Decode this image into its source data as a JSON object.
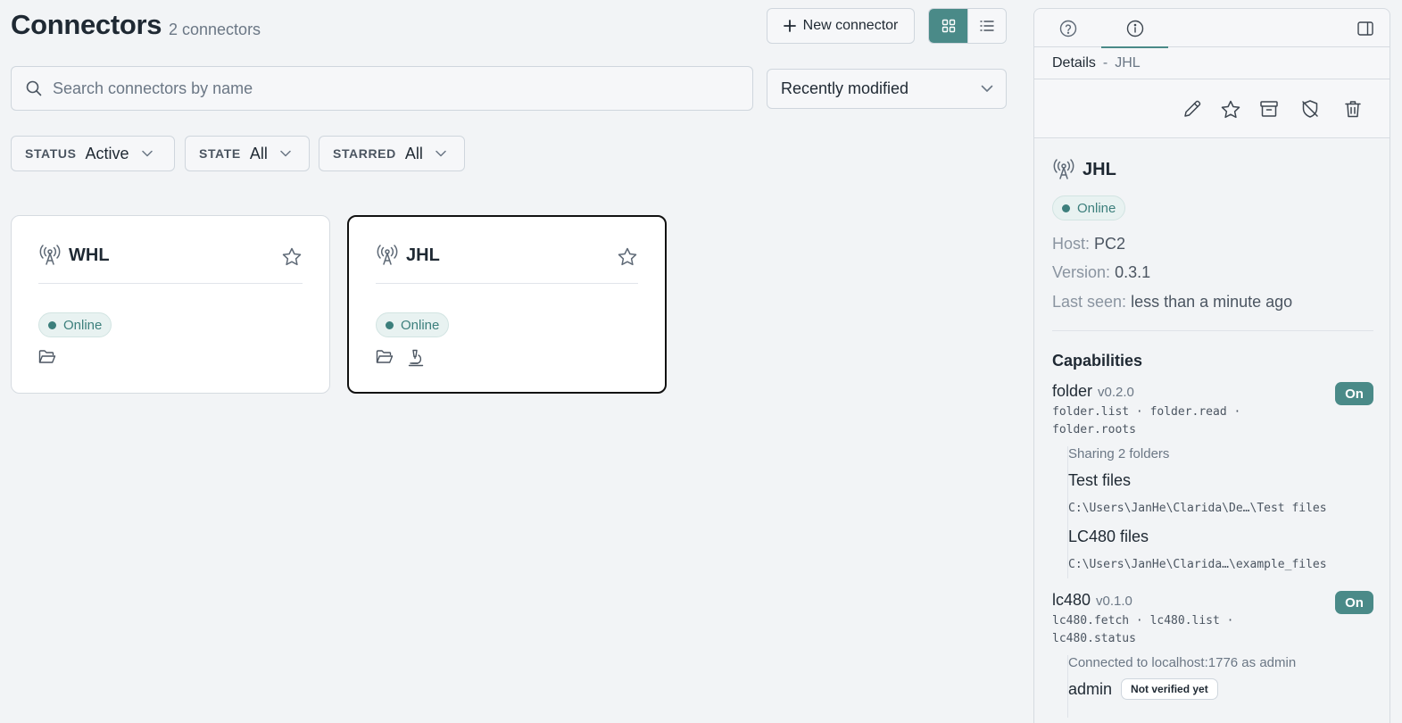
{
  "header": {
    "title": "Connectors",
    "count": "2 connectors",
    "new_button": "New connector",
    "view_grid_icon": "grid-icon",
    "view_list_icon": "list-icon"
  },
  "search": {
    "placeholder": "Search connectors by name",
    "value": ""
  },
  "sort": {
    "selected": "Recently modified"
  },
  "filters": [
    {
      "key": "STATUS",
      "value": "Active"
    },
    {
      "key": "STATE",
      "value": "All"
    },
    {
      "key": "STARRED",
      "value": "All"
    }
  ],
  "cards": [
    {
      "name": "WHL",
      "status": "Online",
      "selected": false,
      "capabilities": [
        "folder-icon"
      ]
    },
    {
      "name": "JHL",
      "status": "Online",
      "selected": true,
      "capabilities": [
        "folder-icon",
        "microscope-icon"
      ]
    }
  ],
  "panel": {
    "tabs": [
      "help-icon",
      "info-icon"
    ],
    "breadcrumb": {
      "section": "Details",
      "separator": "-",
      "item": "JHL"
    },
    "actions": [
      "edit-icon",
      "star-icon",
      "archive-icon",
      "disable-icon",
      "delete-icon"
    ],
    "name": "JHL",
    "status": "Online",
    "host_label": "Host:",
    "host": "PC2",
    "version_label": "Version:",
    "version": "0.3.1",
    "last_seen_label": "Last seen:",
    "last_seen": "less than a minute ago",
    "capabilities_title": "Capabilities",
    "capabilities": [
      {
        "name": "folder",
        "version": "v0.2.0",
        "state": "On",
        "methods_line1": "folder.list · folder.read ·",
        "methods_line2": "folder.roots",
        "summary": "Sharing 2 folders",
        "folders": [
          {
            "name": "Test files",
            "path": "C:\\Users\\JanHe\\Clarida\\De…\\Test files"
          },
          {
            "name": "LC480 files",
            "path": "C:\\Users\\JanHe\\Clarida…\\example_files"
          }
        ]
      },
      {
        "name": "lc480",
        "version": "v0.1.0",
        "state": "On",
        "methods_line1": "lc480.fetch · lc480.list ·",
        "methods_line2": "lc480.status",
        "summary": "Connected to localhost:1776 as admin",
        "user": "admin",
        "user_tag": "Not verified yet"
      }
    ]
  },
  "colors": {
    "accent": "#4a8a88",
    "online": "#3c7f7c",
    "background": "#f2f4f6"
  }
}
